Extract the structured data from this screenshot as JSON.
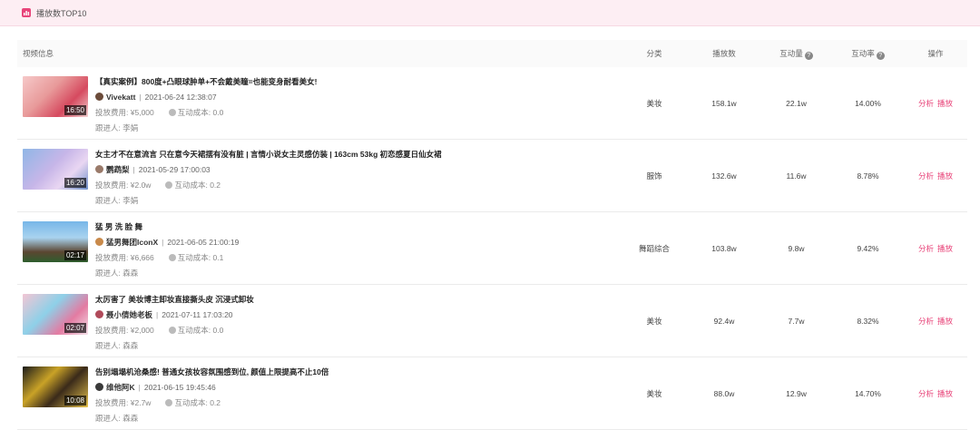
{
  "panel": {
    "title": "播放数TOP10"
  },
  "colors": {
    "accent": "#e8457a",
    "header_bg": "#fdeef3"
  },
  "table": {
    "headers": {
      "info": "视频信息",
      "category": "分类",
      "plays": "播放数",
      "interactions": "互动量",
      "rate": "互动率",
      "ops": "操作"
    },
    "help_glyph": "?",
    "labels": {
      "cost": "投放费用:",
      "inter_cost": "互动成本:",
      "follower": "跟进人:",
      "analyze": "分析",
      "play": "播放",
      "sep": "|"
    },
    "rows": [
      {
        "title": "【真实案例】800度+凸眼球肿单+不会戴美瞳=也能变身耐看美女!",
        "author": "Vivekatt",
        "time": "2021-06-24 12:38:07",
        "cost": "¥5,000",
        "inter_cost": "0.0",
        "follower": "李娟",
        "duration": "16:50",
        "category": "美妆",
        "plays": "158.1w",
        "interactions": "22.1w",
        "rate": "14.00%"
      },
      {
        "title": "女主才不在意流言 只在意今天裙摆有没有脏 | 言情小说女主灵感仿装 | 163cm 53kg 初恋感夏日仙女裙",
        "author": "鹦鹉梨",
        "time": "2021-05-29 17:00:03",
        "cost": "¥2.0w",
        "inter_cost": "0.2",
        "follower": "李娟",
        "duration": "16:20",
        "category": "服饰",
        "plays": "132.6w",
        "interactions": "11.6w",
        "rate": "8.78%"
      },
      {
        "title": "猛 男 洗 脸 舞",
        "author": "猛男舞团IconX",
        "time": "2021-06-05 21:00:19",
        "cost": "¥6,666",
        "inter_cost": "0.1",
        "follower": "森森",
        "duration": "02:17",
        "category": "舞蹈综合",
        "plays": "103.8w",
        "interactions": "9.8w",
        "rate": "9.42%"
      },
      {
        "title": "太厉害了 美妆博主卸妆直接撕头皮 沉浸式卸妆",
        "author": "聂小倩她老板",
        "time": "2021-07-11 17:03:20",
        "cost": "¥2,000",
        "inter_cost": "0.0",
        "follower": "森森",
        "duration": "02:07",
        "category": "美妆",
        "plays": "92.4w",
        "interactions": "7.7w",
        "rate": "8.32%"
      },
      {
        "title": "告别塌塌机沧桑感! 普通女孩妆容氛围感到位, 颜值上限提高不止10倍",
        "author": "维他阿K",
        "time": "2021-06-15 19:45:46",
        "cost": "¥2.7w",
        "inter_cost": "0.2",
        "follower": "森森",
        "duration": "10:08",
        "category": "美妆",
        "plays": "88.0w",
        "interactions": "12.9w",
        "rate": "14.70%"
      }
    ]
  }
}
